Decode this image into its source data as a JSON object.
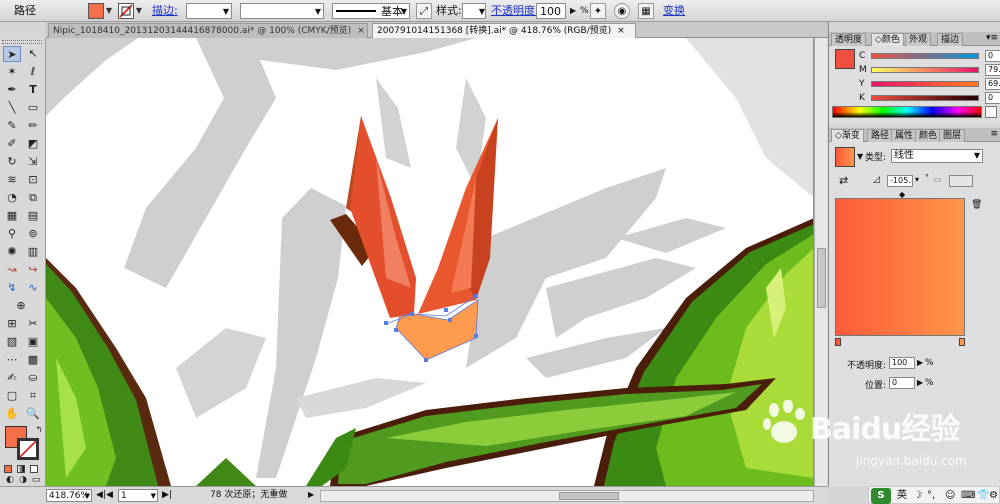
{
  "control_bar": {
    "object_type": "路径",
    "stroke_label": "描边:",
    "stroke_style": "基本",
    "style_label": "样式:",
    "opacity_label": "不透明度:",
    "opacity_value": "100",
    "opacity_unit": "%",
    "transform_label": "变换"
  },
  "doc_tabs": [
    {
      "label": "Nipic_1018410_20131203144416878000.ai* @ 100% (CMYK/预览)",
      "close": "×"
    },
    {
      "label": "200791014151368 [转换].ai* @ 418.76% (RGB/预览)",
      "close": "×"
    }
  ],
  "color_panel": {
    "tabs": [
      "透明度",
      "颜色",
      "外观",
      "描边"
    ],
    "channels": [
      {
        "label": "C",
        "value": "0"
      },
      {
        "label": "M",
        "value": "79.59"
      },
      {
        "label": "Y",
        "value": "69.99"
      },
      {
        "label": "K",
        "value": "0"
      }
    ],
    "unit": "%",
    "fill_color": "#f04e3e"
  },
  "gradient_panel": {
    "tabs": [
      "渐变",
      "路径",
      "属性",
      "颜色",
      "图层"
    ],
    "type_label": "类型:",
    "type_value": "线性",
    "angle_value": "-105.",
    "opacity_label": "不透明度:",
    "opacity_value": "100",
    "position_label": "位置:",
    "position_value": "0",
    "unit": "%",
    "start_color": "#ff5a3a",
    "end_color": "#ff9648"
  },
  "status_bar": {
    "zoom": "418.76%",
    "artboard": "1",
    "message": "78 次还原；无重做"
  },
  "ime": {
    "lang": "英"
  },
  "watermark": {
    "text": "Baidu经验",
    "url": "jingyan.baidu.com"
  },
  "tool_icons": [
    "selection-icon",
    "direct-selection-icon",
    "magic-wand-icon",
    "lasso-icon",
    "pen-icon",
    "type-icon",
    "line-icon",
    "rectangle-icon",
    "paintbrush-icon",
    "pencil-icon",
    "blob-brush-icon",
    "eraser-icon",
    "rotate-icon",
    "scale-icon",
    "warp-icon",
    "free-transform-icon",
    "shape-builder-icon",
    "perspective-icon",
    "mesh-icon",
    "gradient-icon",
    "eyedropper-icon",
    "blend-icon",
    "symbol-sprayer-icon",
    "column-graph-icon",
    "artboard-icon",
    "slice-icon",
    "hand-icon",
    "zoom-icon"
  ]
}
